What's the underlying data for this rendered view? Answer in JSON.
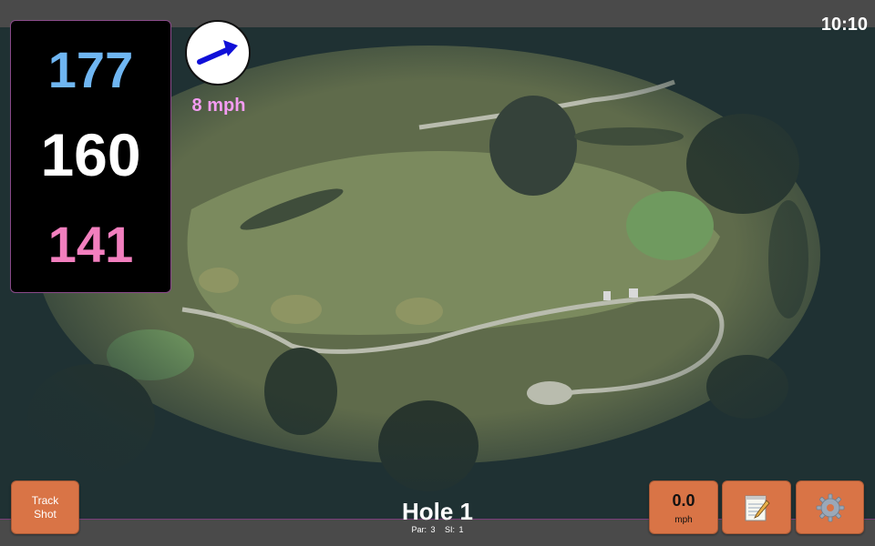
{
  "clock": "10:10",
  "distances": {
    "back": "177",
    "middle": "160",
    "front": "141"
  },
  "wind": {
    "speed_label": "8 mph",
    "direction_icon": "arrow-icon"
  },
  "buttons": {
    "track_shot": [
      "Track",
      "Shot"
    ],
    "speed_value": "0.0",
    "speed_unit": "mph",
    "notes_icon": "notepad-icon",
    "settings_icon": "gear-icon"
  },
  "hole": {
    "title": "Hole 1",
    "par_label": "Par: 3",
    "si_label": "SI: 1"
  },
  "colors": {
    "back_distance": "#6fb6f2",
    "middle_distance": "#ffffff",
    "front_distance": "#f27fbe",
    "wind_label": "#f49cf2",
    "button_fill": "#d97446",
    "wind_arrow": "#1010d8"
  }
}
